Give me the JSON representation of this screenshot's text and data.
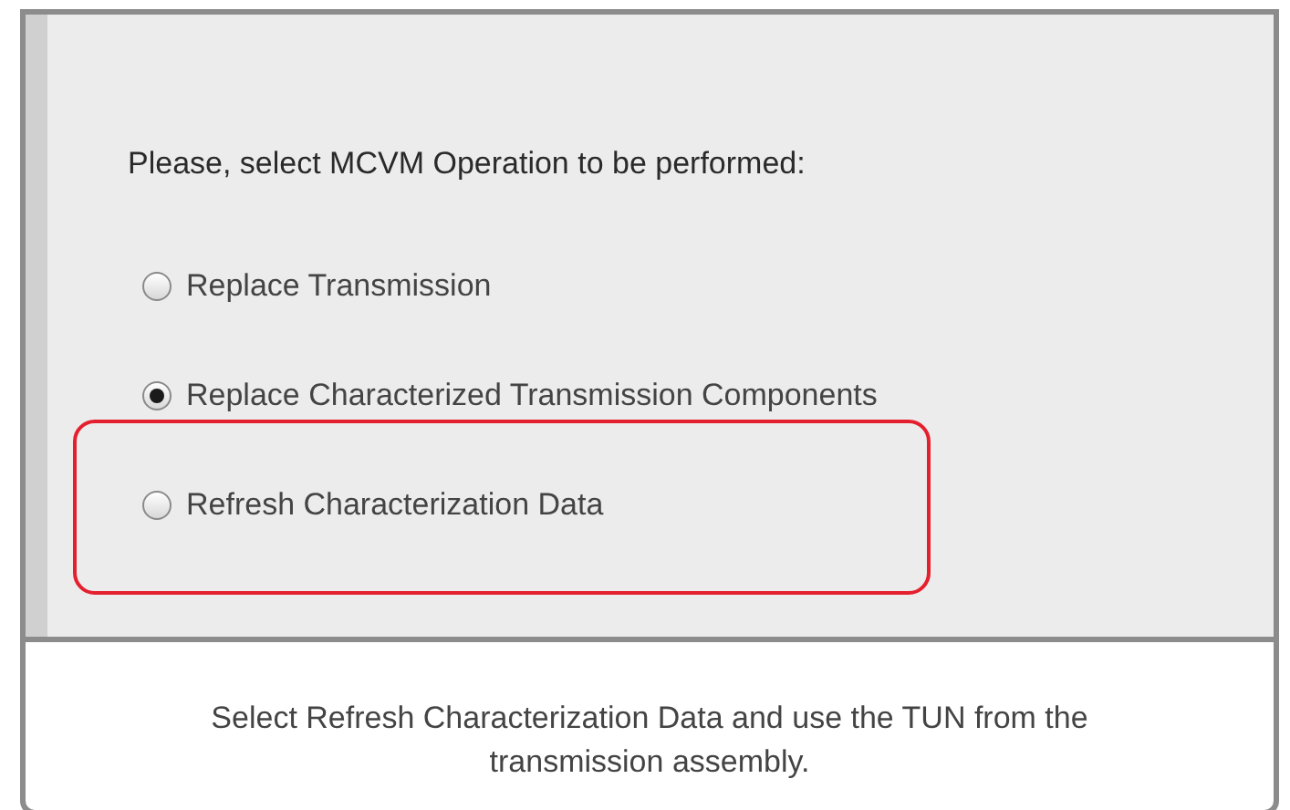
{
  "dialog": {
    "heading": "Please, select MCVM Operation to be performed:",
    "options": [
      {
        "label": "Replace Transmission",
        "selected": false,
        "highlighted": false
      },
      {
        "label": "Replace Characterized Transmission Components",
        "selected": true,
        "highlighted": false
      },
      {
        "label": "Refresh Characterization Data",
        "selected": false,
        "highlighted": true
      }
    ]
  },
  "caption": "Select Refresh Characterization Data and use the TUN from the transmission assembly."
}
